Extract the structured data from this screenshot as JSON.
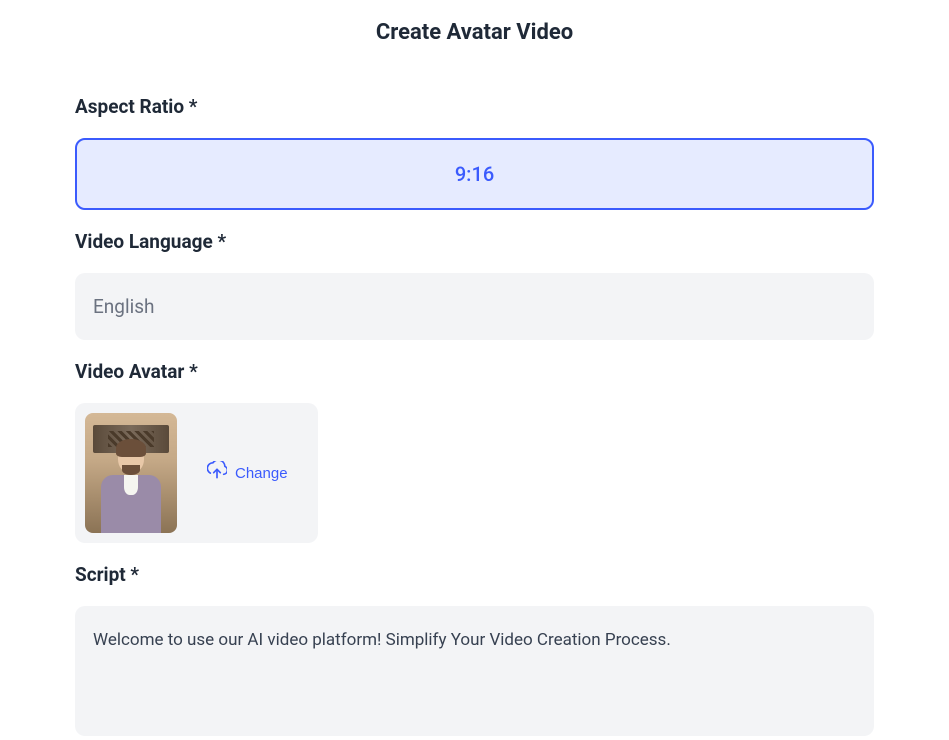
{
  "page_title": "Create Avatar Video",
  "aspect_ratio": {
    "label": "Aspect Ratio *",
    "value": "9:16"
  },
  "video_language": {
    "label": "Video Language *",
    "value": "English"
  },
  "video_avatar": {
    "label": "Video Avatar *",
    "change_button": "Change"
  },
  "script": {
    "label": "Script *",
    "value": "Welcome to use our AI video platform! Simplify Your Video Creation Process."
  },
  "colors": {
    "accent": "#3b5bfd",
    "accent_bg": "#e6ebff",
    "input_bg": "#f3f4f6",
    "text": "#1f2937",
    "muted": "#6b7280"
  }
}
